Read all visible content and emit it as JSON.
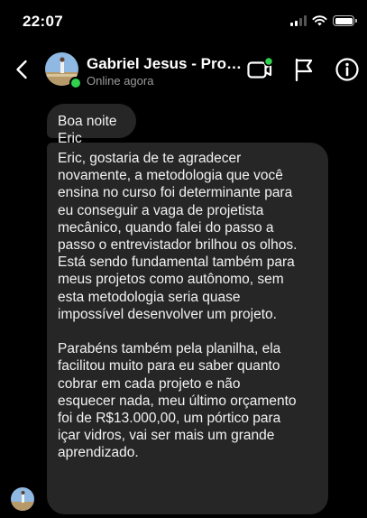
{
  "status_bar": {
    "time": "22:07",
    "icons": [
      "cellular-signal-icon",
      "wifi-icon",
      "battery-icon"
    ]
  },
  "header": {
    "contact_name": "Gabriel Jesus - Projetista",
    "contact_status": "Online agora",
    "online_indicator_color": "#2fd14e",
    "actions": [
      "back-icon",
      "video-call-icon",
      "flag-icon",
      "info-icon"
    ]
  },
  "messages": [
    {
      "sender": "Gabriel Jesus",
      "paragraphs": [
        "Boa noite Eric"
      ]
    },
    {
      "sender": "Gabriel Jesus",
      "paragraphs": [
        "Eric, gostaria de te agradecer\nnovamente, a metodologia que você\nensina no curso foi determinante para\neu conseguir a vaga de projetista\nmecânico, quando falei do passo a\npasso o entrevistador brilhou os olhos.\nEstá sendo fundamental também para\nmeus projetos como autônomo, sem\nesta metodologia seria quase\nimpossível desenvolver um projeto.",
        "Parabéns também pela planilha, ela\nfacilitou muito para eu saber quanto\ncobrar em cada projeto e não\nesquecer nada, meu último orçamento\nfoi de R$13.000,00, um pórtico para\niçar vidros, vai ser mais um grande\naprendizado."
      ]
    }
  ],
  "colors": {
    "background": "#000000",
    "bubble": "#262626",
    "text": "#f2f2f2",
    "secondary_text": "#9a9a9a"
  }
}
